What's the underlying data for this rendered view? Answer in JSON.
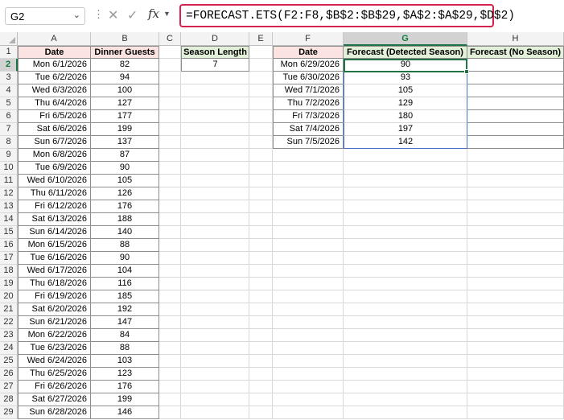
{
  "name_box": "G2",
  "formula": "=FORECAST.ETS(F2:F8,$B$2:$B$29,$A$2:$A$29,$D$2)",
  "icons": {
    "cancel": "cancel-x-icon",
    "enter": "checkmark-icon",
    "fx": "function-icon"
  },
  "columns": [
    "A",
    "B",
    "C",
    "D",
    "E",
    "F",
    "G",
    "H"
  ],
  "headers": {
    "date": "Date",
    "guests": "Dinner Guests",
    "season": "Season Length",
    "f_date": "Date",
    "f_detected": "Forecast (Detected Season)",
    "f_noseason": "Forecast (No Season)"
  },
  "season_length": "7",
  "history": [
    {
      "date": "Mon 6/1/2026",
      "guests": "82"
    },
    {
      "date": "Tue 6/2/2026",
      "guests": "94"
    },
    {
      "date": "Wed 6/3/2026",
      "guests": "100"
    },
    {
      "date": "Thu 6/4/2026",
      "guests": "127"
    },
    {
      "date": "Fri 6/5/2026",
      "guests": "177"
    },
    {
      "date": "Sat 6/6/2026",
      "guests": "199"
    },
    {
      "date": "Sun 6/7/2026",
      "guests": "137"
    },
    {
      "date": "Mon 6/8/2026",
      "guests": "87"
    },
    {
      "date": "Tue 6/9/2026",
      "guests": "90"
    },
    {
      "date": "Wed 6/10/2026",
      "guests": "105"
    },
    {
      "date": "Thu 6/11/2026",
      "guests": "126"
    },
    {
      "date": "Fri 6/12/2026",
      "guests": "176"
    },
    {
      "date": "Sat 6/13/2026",
      "guests": "188"
    },
    {
      "date": "Sun 6/14/2026",
      "guests": "140"
    },
    {
      "date": "Mon 6/15/2026",
      "guests": "88"
    },
    {
      "date": "Tue 6/16/2026",
      "guests": "90"
    },
    {
      "date": "Wed 6/17/2026",
      "guests": "104"
    },
    {
      "date": "Thu 6/18/2026",
      "guests": "116"
    },
    {
      "date": "Fri 6/19/2026",
      "guests": "185"
    },
    {
      "date": "Sat 6/20/2026",
      "guests": "192"
    },
    {
      "date": "Sun 6/21/2026",
      "guests": "147"
    },
    {
      "date": "Mon 6/22/2026",
      "guests": "84"
    },
    {
      "date": "Tue 6/23/2026",
      "guests": "88"
    },
    {
      "date": "Wed 6/24/2026",
      "guests": "103"
    },
    {
      "date": "Thu 6/25/2026",
      "guests": "123"
    },
    {
      "date": "Fri 6/26/2026",
      "guests": "176"
    },
    {
      "date": "Sat 6/27/2026",
      "guests": "199"
    },
    {
      "date": "Sun 6/28/2026",
      "guests": "146"
    }
  ],
  "forecast": [
    {
      "date": "Mon 6/29/2026",
      "detected": "90",
      "noseason": ""
    },
    {
      "date": "Tue 6/30/2026",
      "detected": "93",
      "noseason": ""
    },
    {
      "date": "Wed 7/1/2026",
      "detected": "105",
      "noseason": ""
    },
    {
      "date": "Thu 7/2/2026",
      "detected": "129",
      "noseason": ""
    },
    {
      "date": "Fri 7/3/2026",
      "detected": "180",
      "noseason": ""
    },
    {
      "date": "Sat 7/4/2026",
      "detected": "197",
      "noseason": ""
    },
    {
      "date": "Sun 7/5/2026",
      "detected": "142",
      "noseason": ""
    }
  ],
  "colors": {
    "header_pink": "#fbe3e2",
    "header_green": "#e2efd9",
    "formula_border": "#d4234e",
    "selection_green": "#217346",
    "range_blue": "#4472c4"
  }
}
